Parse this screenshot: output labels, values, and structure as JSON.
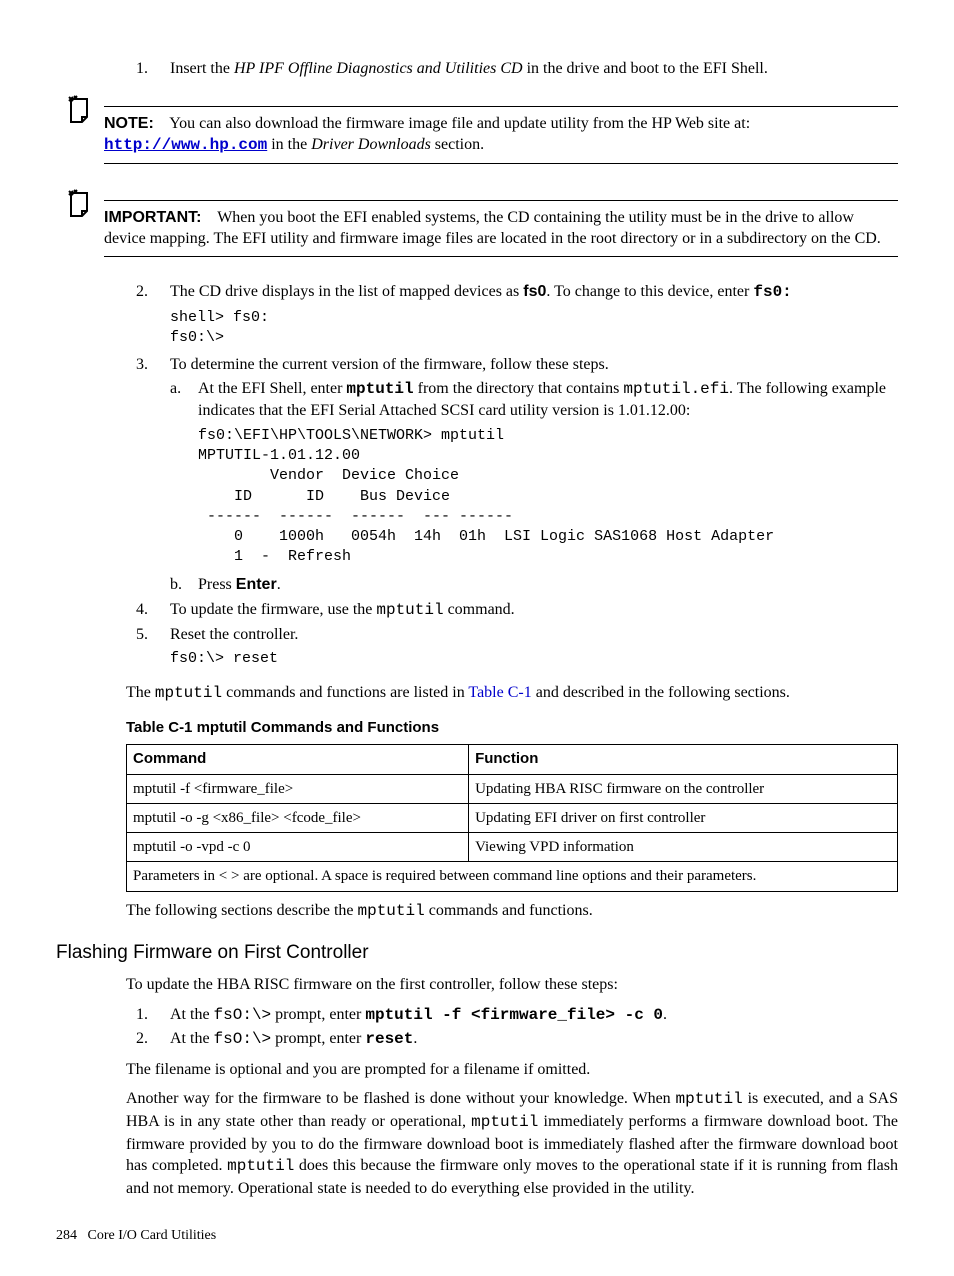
{
  "steps": {
    "s1": {
      "num": "1.",
      "pre": "Insert the ",
      "italic": "HP IPF Offline Diagnostics and Utilities CD",
      "post": " in the drive and boot to the EFI Shell."
    },
    "note": {
      "label": "NOTE:",
      "pre": "You can also download the firmware image file and update utility from the HP Web site at: ",
      "link": "http://www.hp.com",
      "mid": " in the ",
      "italic": "Driver Downloads",
      "post": " section."
    },
    "important": {
      "label": "IMPORTANT:",
      "text": "When you boot the EFI enabled systems, the CD containing the utility must be in the drive to allow device mapping. The EFI utility and firmware image files are located in the root directory or in a subdirectory on the CD."
    },
    "s2": {
      "num": "2.",
      "pre": "The CD drive displays in the list of mapped devices as ",
      "bold1": "fs0",
      "mid": ". To change to this device, enter ",
      "bold2": "fs0:",
      "code": "shell> fs0:\nfs0:\\>"
    },
    "s3": {
      "num": "3.",
      "text": "To determine the current version of the firmware, follow these steps.",
      "a": {
        "num": "a.",
        "pre": "At the EFI Shell, enter ",
        "cmdB": "mptutil",
        "mid1": " from the directory that contains ",
        "cmd2": "mptutil.efi",
        "post": ". The following example indicates that the EFI Serial Attached SCSI card utility version is 1.01.12.00:",
        "code": "fs0:\\EFI\\HP\\TOOLS\\NETWORK> mptutil\nMPTUTIL-1.01.12.00\n        Vendor  Device Choice\n    ID      ID    Bus Device\n ------  ------  ------  --- ------\n    0    1000h   0054h  14h  01h  LSI Logic SAS1068 Host Adapter\n    1  -  Refresh"
      },
      "b": {
        "num": "b.",
        "pre": "Press ",
        "bold": "Enter",
        "post": "."
      }
    },
    "s4": {
      "num": "4.",
      "pre": "To update the firmware, use the ",
      "cmd": "mptutil",
      "post": " command."
    },
    "s5": {
      "num": "5.",
      "text": "Reset the controller.",
      "code": "fs0:\\> reset"
    }
  },
  "after_steps": {
    "pre": "The ",
    "cmd": "mptutil",
    "mid": " commands and functions are listed in ",
    "xref": "Table C-1",
    "post": " and described in the following sections."
  },
  "table": {
    "caption": "Table  C-1  mptutil Commands and Functions",
    "hdr": {
      "c1": "Command",
      "c2": "Function"
    },
    "rows": [
      {
        "c1": "mptutil -f <firmware_file>",
        "c2": "Updating HBA RISC firmware on the controller"
      },
      {
        "c1": "mptutil -o -g <x86_file> <fcode_file>",
        "c2": "Updating EFI driver on first controller"
      },
      {
        "c1": "mptutil -o -vpd -c 0",
        "c2": "Viewing VPD information"
      }
    ],
    "note": "Parameters in < > are optional. A space is required between command line options and their parameters."
  },
  "after_table": {
    "pre": "The following sections describe the ",
    "cmd": "mptutil",
    "post": " commands and functions."
  },
  "section": {
    "title": "Flashing Firmware on First Controller",
    "intro": "To update the HBA RISC firmware on the first controller, follow these steps:",
    "s1": {
      "num": "1.",
      "pre": "At the ",
      "cmd": "fsO:\\>",
      "mid": " prompt, enter ",
      "cmdB": "mptutil -f <firmware_file> -c 0",
      "post": "."
    },
    "s2": {
      "num": "2.",
      "pre": "At the ",
      "cmd": "fsO:\\>",
      "mid": " prompt, enter ",
      "cmdB": "reset",
      "post": "."
    },
    "p1": "The filename is optional and you are prompted for a filename if omitted.",
    "p2": {
      "pre": "Another way for the firmware to be flashed is done without your knowledge. When ",
      "c1": "mptutil",
      "m1": " is executed, and a SAS HBA is in any state other than ready or operational, ",
      "c2": "mptutil",
      "m2": " immediately performs a firmware download boot. The firmware provided by you to do the firmware download boot is immediately flashed after the firmware download boot has completed. ",
      "c3": "mptutil",
      "m3": " does this because the firmware only moves to the operational state if it is running from flash and not memory. Operational state is needed to do everything else provided in the utility."
    }
  },
  "footer": {
    "page": "284",
    "title": "Core I/O Card Utilities"
  }
}
